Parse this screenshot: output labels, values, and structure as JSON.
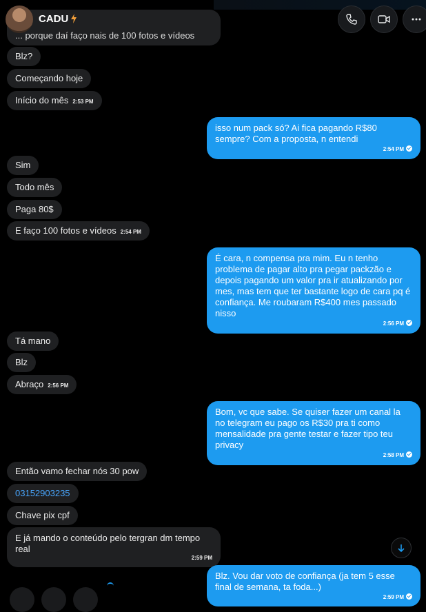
{
  "header": {
    "name": "CADU"
  },
  "messages": {
    "m0": "... porque daí faço nais de 100 fotos e vídeos",
    "m1": "Blz?",
    "m2": "Começando hoje",
    "m3": "Início do mês",
    "m3_time": "2:53 PM",
    "m4": "isso num pack só? Ai fica pagando R$80 sempre? Com a proposta, n entendi",
    "m4_time": "2:54 PM",
    "m5": "Sim",
    "m6": "Todo mês",
    "m7": "Paga 80$",
    "m8": "E faço 100 fotos e vídeos",
    "m8_time": "2:54 PM",
    "m9": "É cara, n compensa pra mim. Eu n tenho problema de pagar alto pra pegar packzão e depois pagando um valor pra ir atualizando por mes, mas tem que ter bastante logo de cara pq é confiança. Me roubaram R$400 mes passado nisso",
    "m9_time": "2:56 PM",
    "m10": "Tá mano",
    "m11": "Blz",
    "m12": "Abraço",
    "m12_time": "2:56 PM",
    "m13": "Bom, vc que sabe. Se quiser fazer um canal la no telegram eu pago os R$30 pra ti como mensalidade pra gente testar e fazer tipo teu privacy",
    "m13_time": "2:58 PM",
    "m14": "Então vamo fechar nós 30 pow",
    "m15": "03152903235",
    "m16": "Chave pix cpf",
    "m17": "E já mando o conteúdo pelo tergran dm tempo real",
    "m17_time": "2:59 PM",
    "m18": "Blz. Vou dar voto de confiança (ja tem 5 esse final de semana, ta foda...)",
    "m18_time": "2:59 PM"
  },
  "colors": {
    "outgoing": "#1d9bf0",
    "incoming": "#1f2022",
    "background": "#000000",
    "link": "#49a7ff"
  },
  "icons": [
    "phone-icon",
    "video-icon",
    "more-icon",
    "verified-bolt-icon",
    "scroll-down-arrow-icon"
  ]
}
